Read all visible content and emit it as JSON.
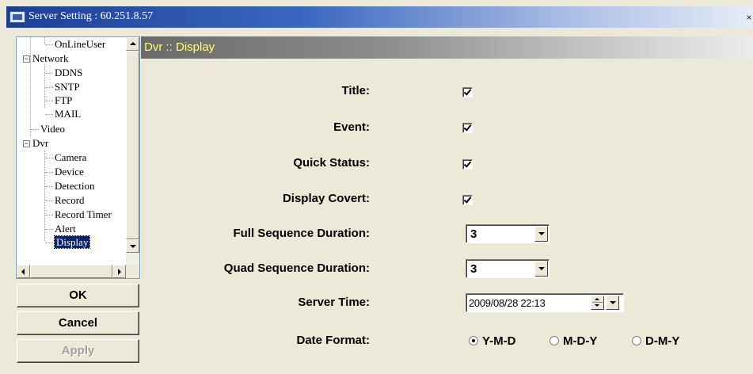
{
  "window": {
    "title": "Server Setting : 60.251.8.57",
    "close_glyph": "×"
  },
  "tree": {
    "items": [
      {
        "label": "OnLineUser",
        "level": 2
      },
      {
        "label": "Network",
        "level": 1,
        "toggle": "−"
      },
      {
        "label": "DDNS",
        "level": 2
      },
      {
        "label": "SNTP",
        "level": 2
      },
      {
        "label": "FTP",
        "level": 2
      },
      {
        "label": "MAIL",
        "level": 2
      },
      {
        "label": "Video",
        "level": 1
      },
      {
        "label": "Dvr",
        "level": 1,
        "toggle": "−"
      },
      {
        "label": "Camera",
        "level": 2
      },
      {
        "label": "Device",
        "level": 2
      },
      {
        "label": "Detection",
        "level": 2
      },
      {
        "label": "Record",
        "level": 2
      },
      {
        "label": "Record Timer",
        "level": 2
      },
      {
        "label": "Alert",
        "level": 2
      },
      {
        "label": "Display",
        "level": 2,
        "selected": true
      }
    ]
  },
  "buttons": {
    "ok": "OK",
    "cancel": "Cancel",
    "apply": "Apply"
  },
  "panel": {
    "header": "Dvr :: Display",
    "header_color": "#ffff66"
  },
  "settings": {
    "title_label": "Title:",
    "title_checked": true,
    "event_label": "Event:",
    "event_checked": true,
    "quick_status_label": "Quick Status:",
    "quick_status_checked": true,
    "display_covert_label": "Display Covert:",
    "display_covert_checked": true,
    "full_seq_label": "Full Sequence Duration:",
    "full_seq_value": "3",
    "quad_seq_label": "Quad Sequence Duration:",
    "quad_seq_value": "3",
    "server_time_label": "Server Time:",
    "server_time_value": "2009/08/28 22:13",
    "date_format_label": "Date Format:",
    "date_format_options": [
      "Y-M-D",
      "M-D-Y",
      "D-M-Y"
    ],
    "date_format_selected": "Y-M-D"
  }
}
